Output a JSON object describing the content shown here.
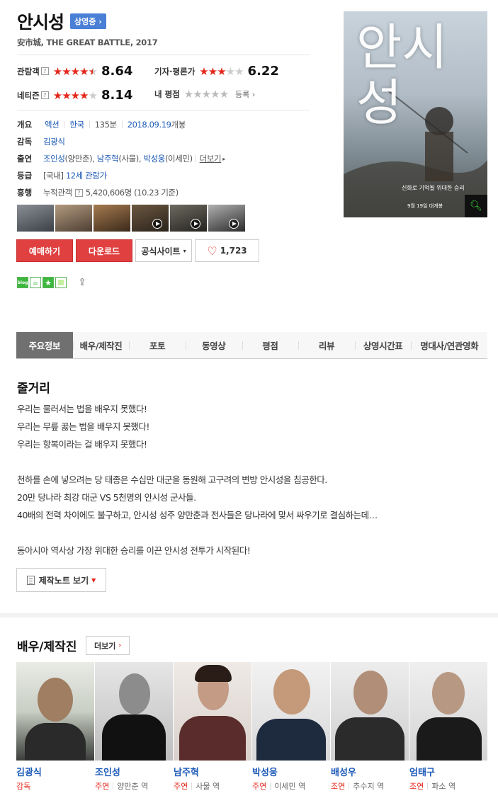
{
  "movie": {
    "title": "안시성",
    "status": "상영중",
    "subtitle": "安市城, THE GREAT BATTLE, 2017"
  },
  "ratings": {
    "audience": {
      "label": "관람객",
      "help": "?",
      "score": "8.64",
      "stars": 4.3
    },
    "critic": {
      "label": "기자·평론가",
      "score": "6.22",
      "stars": 3.1
    },
    "netizen": {
      "label": "네티즌",
      "help": "?",
      "score": "8.14",
      "stars": 4.1
    },
    "my": {
      "label": "내 평점",
      "register": "등록"
    }
  },
  "info": {
    "overview_key": "개요",
    "genre": "액션",
    "country": "한국",
    "runtime": "135분",
    "release": "2018.09.19",
    "release_suffix": "개봉",
    "director_key": "감독",
    "director": "김광식",
    "cast_key": "출연",
    "cast1": "조인성",
    "cast1_role": "(양만춘)",
    "cast2": "남주혁",
    "cast2_role": "(사물)",
    "cast3": "박성웅",
    "cast3_role": "(이세민)",
    "cast_more": "더보기",
    "grade_key": "등급",
    "grade_prefix": "[국내]",
    "grade": "12세 관람가",
    "box_key": "흥행",
    "box_label": "누적관객",
    "box_help": "?",
    "box_value": "5,420,606명 (10.23 기준)"
  },
  "buttons": {
    "reserve": "예매하기",
    "download": "다운로드",
    "official": "공식사이트",
    "likes": "1,723"
  },
  "poster": {
    "title_text": "안시성",
    "tagline": "신화로 기억될 위대한 승리",
    "date": "9월 19일 대개봉"
  },
  "tabs": [
    "주요정보",
    "배우/제작진",
    "포토",
    "동영상",
    "평점",
    "리뷰",
    "상영시간표",
    "명대사/연관영화"
  ],
  "synopsis": {
    "title": "줄거리",
    "lines": [
      "우리는 물러서는 법을 배우지 못했다!",
      " 우리는 무릎 꿇는 법을 배우지 못했다!",
      " 우리는 항복이라는 걸 배우지 못했다!",
      "",
      " 천하를 손에 넣으려는 당 태종은 수십만 대군을 동원해 고구려의 변방 안시성을 침공한다.",
      " 20만 당나라 최강 대군 VS 5천명의 안시성 군사들.",
      " 40배의 전력 차이에도 불구하고, 안시성 성주 양만춘과 전사들은 당나라에 맞서 싸우기로 결심하는데…",
      "",
      "동아시아 역사상 가장 위대한 승리를 이끈 안시성 전투가 시작된다!"
    ],
    "note_button": "제작노트 보기"
  },
  "cast_section": {
    "title": "배우/제작진",
    "more": "더보기",
    "people": [
      {
        "name": "김광식",
        "role": "감독",
        "character": ""
      },
      {
        "name": "조인성",
        "role": "주연",
        "character": "양만춘 역"
      },
      {
        "name": "남주혁",
        "role": "주연",
        "character": "사물 역"
      },
      {
        "name": "박성웅",
        "role": "주연",
        "character": "이세민 역"
      },
      {
        "name": "배성우",
        "role": "조연",
        "character": "추수지 역"
      },
      {
        "name": "엄태구",
        "role": "조연",
        "character": "파소 역"
      }
    ]
  },
  "sns": {
    "blog": "blog"
  },
  "colors": {
    "accent_red": "#e3271b",
    "link_blue": "#1e5bb8",
    "badge_blue": "#4a7fd6"
  }
}
